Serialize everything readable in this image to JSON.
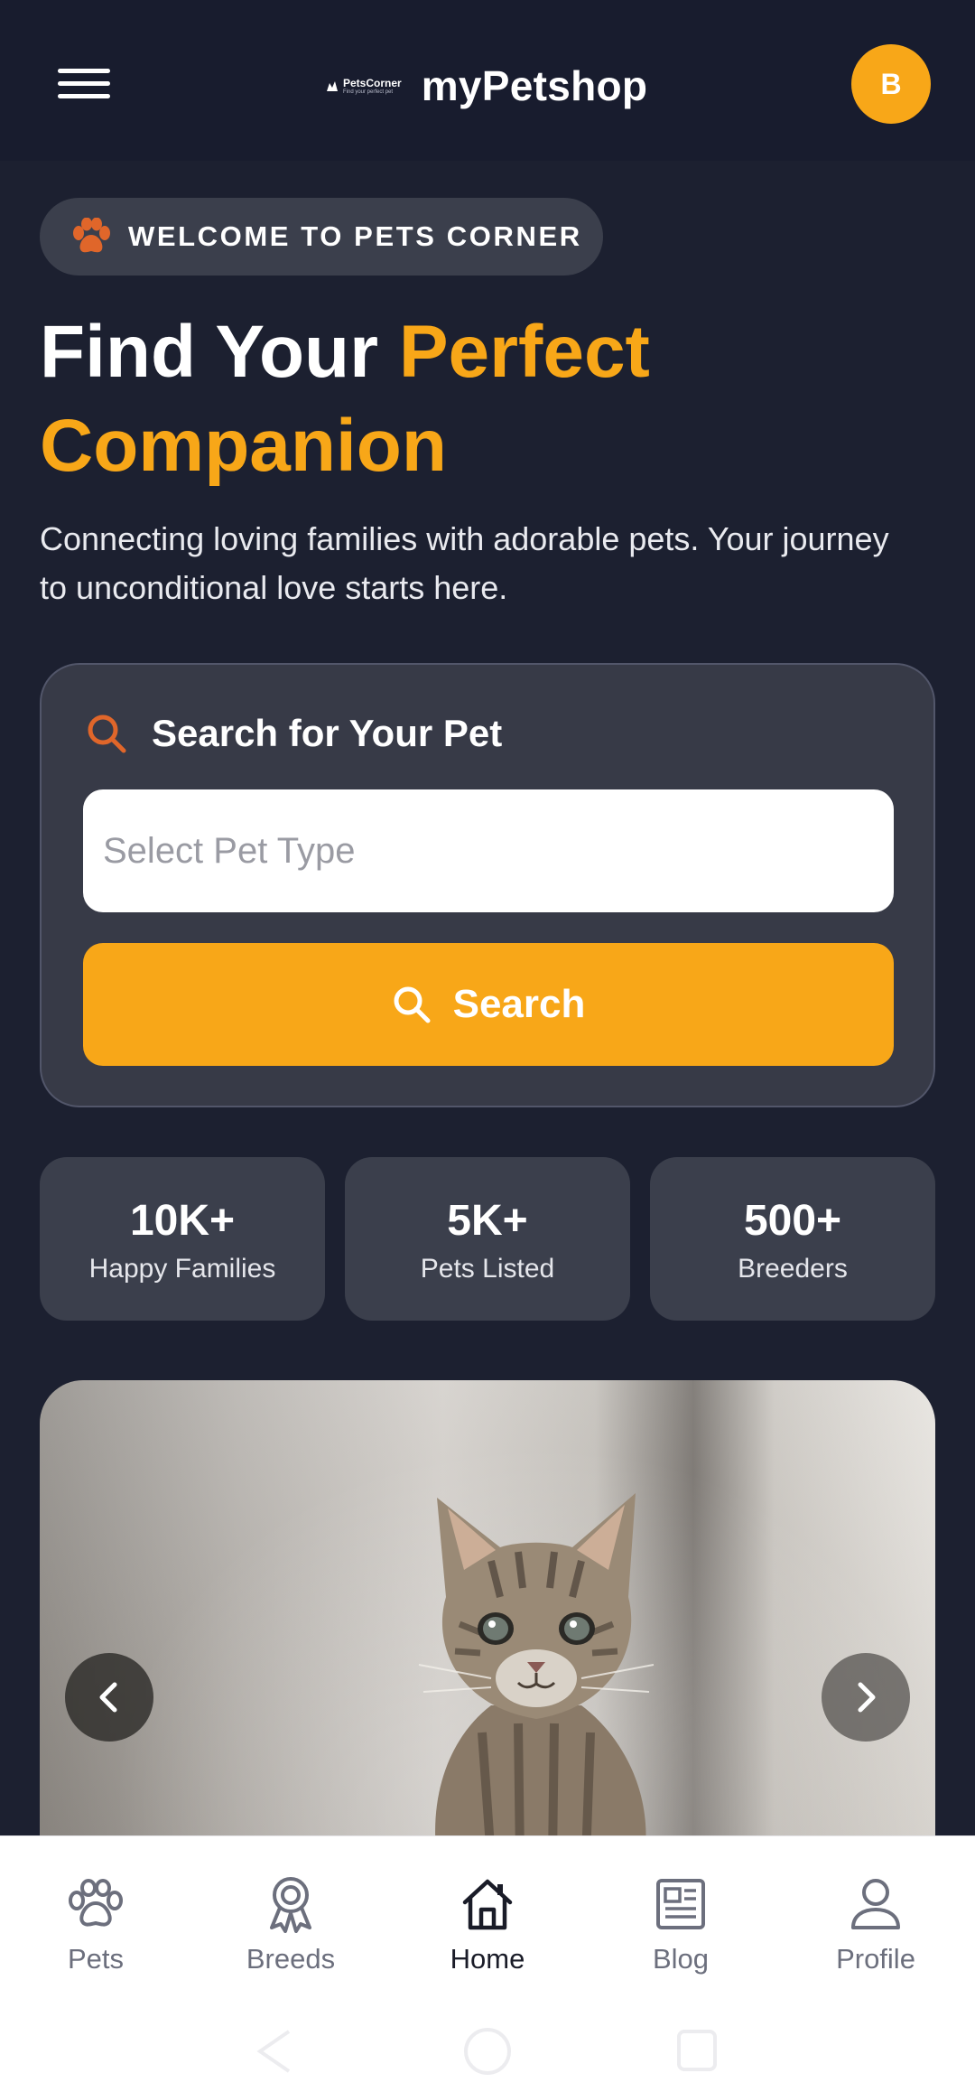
{
  "header": {
    "logo_text": "PetsCorner",
    "logo_tagline": "Find your perfect pet",
    "app_name": "myPetshop",
    "avatar_initial": "B"
  },
  "welcome": {
    "badge": "WELCOME TO PETS CORNER"
  },
  "hero": {
    "title_start": "Find Your ",
    "title_accent": "Perfect Companion",
    "subtitle": "Connecting loving families with adorable pets. Your journey to unconditional love starts here."
  },
  "search": {
    "title": "Search for Your Pet",
    "placeholder": "Select Pet Type",
    "button_label": "Search"
  },
  "stats": [
    {
      "value": "10K+",
      "label": "Happy Families"
    },
    {
      "value": "5K+",
      "label": "Pets Listed"
    },
    {
      "value": "500+",
      "label": "Breeders"
    }
  ],
  "carousel": {
    "image": "kitten-photo",
    "prev_icon": "chevron-left-icon",
    "next_icon": "chevron-right-icon"
  },
  "bottom_nav": {
    "items": [
      {
        "label": "Pets",
        "icon": "paw-icon"
      },
      {
        "label": "Breeds",
        "icon": "ribbon-icon"
      },
      {
        "label": "Home",
        "icon": "home-icon"
      },
      {
        "label": "Blog",
        "icon": "newspaper-icon"
      },
      {
        "label": "Profile",
        "icon": "person-icon"
      }
    ],
    "active": "Home"
  },
  "colors": {
    "accent": "#f8a718",
    "background": "#1c2030",
    "card": "#373a47",
    "paw": "#e0662a"
  }
}
